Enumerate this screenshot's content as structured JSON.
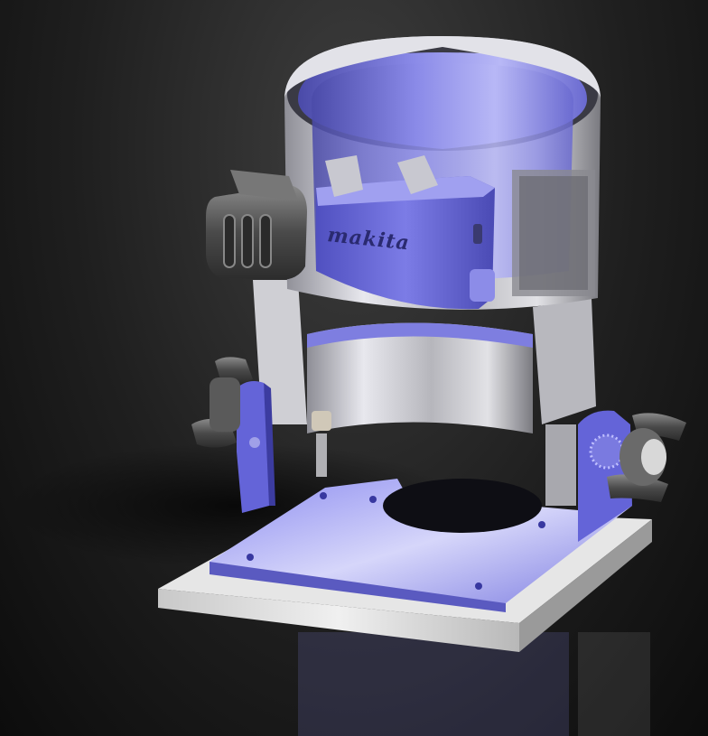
{
  "scene": {
    "brand_text": "makita"
  },
  "colors": {
    "background": "#141414",
    "blue_part": "#6464d8",
    "blue_light": "#b0b0f0",
    "metal_light": "#dedede",
    "metal_mid": "#9a9aa0",
    "knob": "#505050"
  }
}
